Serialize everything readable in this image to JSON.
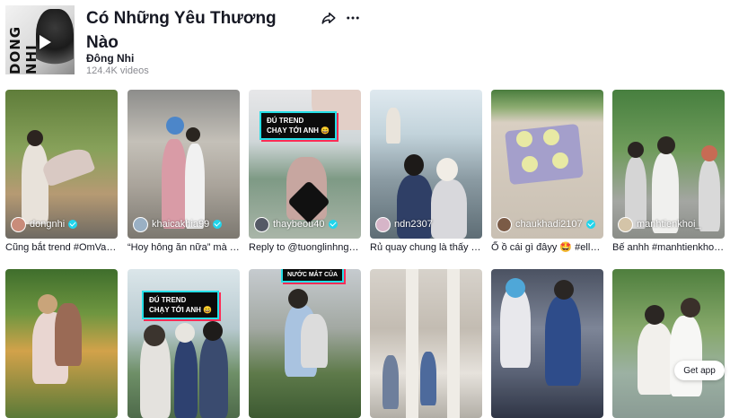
{
  "header": {
    "cover_text": "DONG NHI",
    "title": "Có Những Yêu Thương Nào",
    "artist": "Đông Nhi",
    "video_count": "124.4K videos",
    "share_icon": "share-arrow-icon",
    "more_icon": "more-horizontal-icon"
  },
  "videos": [
    {
      "creator": "dongnhi",
      "verified": true,
      "caption": "Cũng bắt trend #OmVaoTrend ..."
    },
    {
      "creator": "khaicakhia99",
      "verified": true,
      "caption": "“Hoy hông ăn nữa” mà đ..."
    },
    {
      "creator": "thaybeou40",
      "verified": true,
      "caption": "Reply to @tuonglinhngu...",
      "badge": "ĐÚ TREND\nCHẠY TỚI ANH 😄"
    },
    {
      "creator": "ndn2307",
      "verified": false,
      "caption": "Rủ quay chung là thấy n..."
    },
    {
      "creator": "chaukhadi2107",
      "verified": true,
      "caption": "Ố ồ cái gì đâyy 🤩 #ella..."
    },
    {
      "creator": "manhtienkhoi_",
      "verified": false,
      "caption": "Bế anhh #manhtienkhoi ..."
    },
    {
      "creator": "",
      "verified": false,
      "caption": ""
    },
    {
      "creator": "",
      "verified": false,
      "caption": "",
      "badge": "ĐÚ TREND\nCHẠY TỚI ANH 😄"
    },
    {
      "creator": "",
      "verified": false,
      "caption": "",
      "badge_top": "NƯỚC MẮT CỦA"
    },
    {
      "creator": "",
      "verified": false,
      "caption": ""
    },
    {
      "creator": "",
      "verified": false,
      "caption": ""
    },
    {
      "creator": "",
      "verified": false,
      "caption": ""
    }
  ],
  "get_app": "Get app",
  "colors": {
    "verified": "#20d5ec",
    "badge_border": "#25e0e8",
    "badge_shadow": "#fe2c55",
    "text_primary": "#161823",
    "text_secondary": "#8a8b91"
  }
}
